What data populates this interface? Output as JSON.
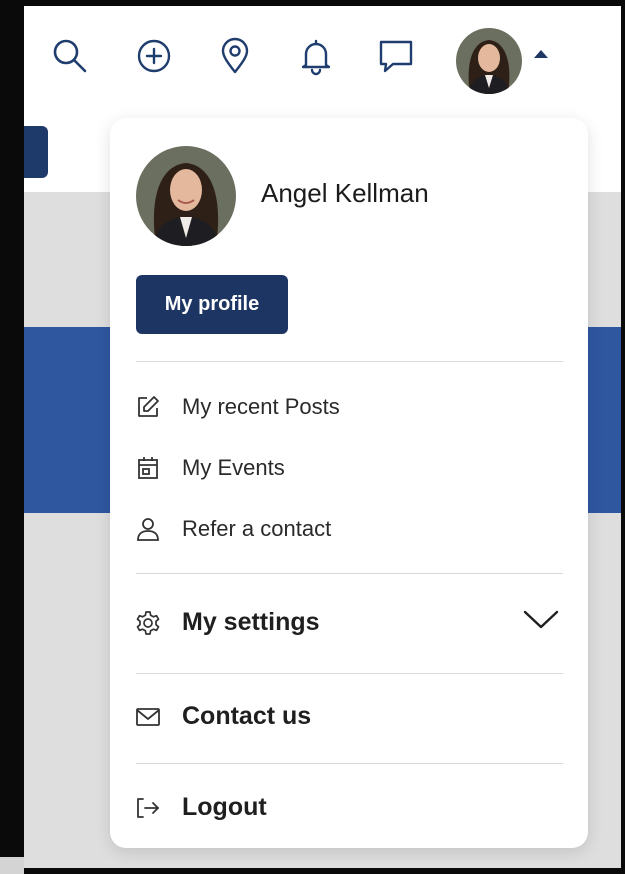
{
  "topbar": {
    "icons": [
      "search-icon",
      "add-circle-icon",
      "location-pin-icon",
      "bell-icon",
      "chat-icon"
    ],
    "accent": "#1f3d6e"
  },
  "profile_menu": {
    "user_name": "Angel Kellman",
    "profile_button": "My profile",
    "items": [
      {
        "label": "My recent Posts",
        "icon": "edit-icon"
      },
      {
        "label": "My Events",
        "icon": "calendar-icon"
      },
      {
        "label": "Refer a contact",
        "icon": "person-icon"
      }
    ],
    "settings": {
      "label": "My settings",
      "icon": "gear-icon",
      "toggle_icon": "chevron-down-icon"
    },
    "contact": {
      "label": "Contact us",
      "icon": "envelope-icon"
    },
    "logout": {
      "label": "Logout",
      "icon": "logout-icon"
    }
  },
  "colors": {
    "button_bg": "#1d3563",
    "banner_blue": "#2f57a0",
    "page_grey": "#dedede",
    "icon_blue": "#1f3d6e"
  }
}
